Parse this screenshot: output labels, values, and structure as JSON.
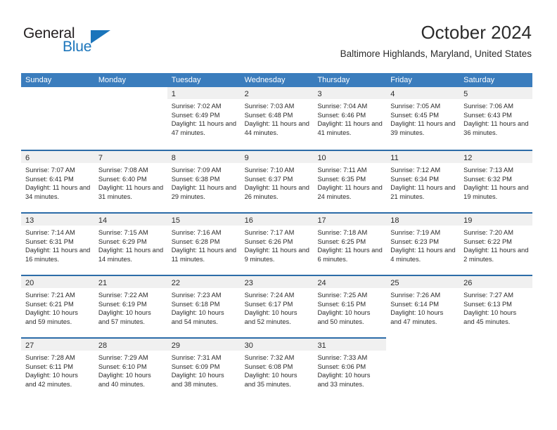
{
  "brand": {
    "name_part1": "General",
    "name_part2": "Blue",
    "accent_color": "#1b75bb"
  },
  "header": {
    "month_title": "October 2024",
    "location": "Baltimore Highlands, Maryland, United States"
  },
  "calendar": {
    "header_bg": "#3b7dbd",
    "rule_color": "#2c6ca8",
    "daynum_bg": "#f0f0f0",
    "weekdays": [
      "Sunday",
      "Monday",
      "Tuesday",
      "Wednesday",
      "Thursday",
      "Friday",
      "Saturday"
    ],
    "weeks": [
      [
        {
          "day": "",
          "empty": true
        },
        {
          "day": "",
          "empty": true
        },
        {
          "day": "1",
          "sunrise": "Sunrise: 7:02 AM",
          "sunset": "Sunset: 6:49 PM",
          "daylight": "Daylight: 11 hours and 47 minutes."
        },
        {
          "day": "2",
          "sunrise": "Sunrise: 7:03 AM",
          "sunset": "Sunset: 6:48 PM",
          "daylight": "Daylight: 11 hours and 44 minutes."
        },
        {
          "day": "3",
          "sunrise": "Sunrise: 7:04 AM",
          "sunset": "Sunset: 6:46 PM",
          "daylight": "Daylight: 11 hours and 41 minutes."
        },
        {
          "day": "4",
          "sunrise": "Sunrise: 7:05 AM",
          "sunset": "Sunset: 6:45 PM",
          "daylight": "Daylight: 11 hours and 39 minutes."
        },
        {
          "day": "5",
          "sunrise": "Sunrise: 7:06 AM",
          "sunset": "Sunset: 6:43 PM",
          "daylight": "Daylight: 11 hours and 36 minutes."
        }
      ],
      [
        {
          "day": "6",
          "sunrise": "Sunrise: 7:07 AM",
          "sunset": "Sunset: 6:41 PM",
          "daylight": "Daylight: 11 hours and 34 minutes."
        },
        {
          "day": "7",
          "sunrise": "Sunrise: 7:08 AM",
          "sunset": "Sunset: 6:40 PM",
          "daylight": "Daylight: 11 hours and 31 minutes."
        },
        {
          "day": "8",
          "sunrise": "Sunrise: 7:09 AM",
          "sunset": "Sunset: 6:38 PM",
          "daylight": "Daylight: 11 hours and 29 minutes."
        },
        {
          "day": "9",
          "sunrise": "Sunrise: 7:10 AM",
          "sunset": "Sunset: 6:37 PM",
          "daylight": "Daylight: 11 hours and 26 minutes."
        },
        {
          "day": "10",
          "sunrise": "Sunrise: 7:11 AM",
          "sunset": "Sunset: 6:35 PM",
          "daylight": "Daylight: 11 hours and 24 minutes."
        },
        {
          "day": "11",
          "sunrise": "Sunrise: 7:12 AM",
          "sunset": "Sunset: 6:34 PM",
          "daylight": "Daylight: 11 hours and 21 minutes."
        },
        {
          "day": "12",
          "sunrise": "Sunrise: 7:13 AM",
          "sunset": "Sunset: 6:32 PM",
          "daylight": "Daylight: 11 hours and 19 minutes."
        }
      ],
      [
        {
          "day": "13",
          "sunrise": "Sunrise: 7:14 AM",
          "sunset": "Sunset: 6:31 PM",
          "daylight": "Daylight: 11 hours and 16 minutes."
        },
        {
          "day": "14",
          "sunrise": "Sunrise: 7:15 AM",
          "sunset": "Sunset: 6:29 PM",
          "daylight": "Daylight: 11 hours and 14 minutes."
        },
        {
          "day": "15",
          "sunrise": "Sunrise: 7:16 AM",
          "sunset": "Sunset: 6:28 PM",
          "daylight": "Daylight: 11 hours and 11 minutes."
        },
        {
          "day": "16",
          "sunrise": "Sunrise: 7:17 AM",
          "sunset": "Sunset: 6:26 PM",
          "daylight": "Daylight: 11 hours and 9 minutes."
        },
        {
          "day": "17",
          "sunrise": "Sunrise: 7:18 AM",
          "sunset": "Sunset: 6:25 PM",
          "daylight": "Daylight: 11 hours and 6 minutes."
        },
        {
          "day": "18",
          "sunrise": "Sunrise: 7:19 AM",
          "sunset": "Sunset: 6:23 PM",
          "daylight": "Daylight: 11 hours and 4 minutes."
        },
        {
          "day": "19",
          "sunrise": "Sunrise: 7:20 AM",
          "sunset": "Sunset: 6:22 PM",
          "daylight": "Daylight: 11 hours and 2 minutes."
        }
      ],
      [
        {
          "day": "20",
          "sunrise": "Sunrise: 7:21 AM",
          "sunset": "Sunset: 6:21 PM",
          "daylight": "Daylight: 10 hours and 59 minutes."
        },
        {
          "day": "21",
          "sunrise": "Sunrise: 7:22 AM",
          "sunset": "Sunset: 6:19 PM",
          "daylight": "Daylight: 10 hours and 57 minutes."
        },
        {
          "day": "22",
          "sunrise": "Sunrise: 7:23 AM",
          "sunset": "Sunset: 6:18 PM",
          "daylight": "Daylight: 10 hours and 54 minutes."
        },
        {
          "day": "23",
          "sunrise": "Sunrise: 7:24 AM",
          "sunset": "Sunset: 6:17 PM",
          "daylight": "Daylight: 10 hours and 52 minutes."
        },
        {
          "day": "24",
          "sunrise": "Sunrise: 7:25 AM",
          "sunset": "Sunset: 6:15 PM",
          "daylight": "Daylight: 10 hours and 50 minutes."
        },
        {
          "day": "25",
          "sunrise": "Sunrise: 7:26 AM",
          "sunset": "Sunset: 6:14 PM",
          "daylight": "Daylight: 10 hours and 47 minutes."
        },
        {
          "day": "26",
          "sunrise": "Sunrise: 7:27 AM",
          "sunset": "Sunset: 6:13 PM",
          "daylight": "Daylight: 10 hours and 45 minutes."
        }
      ],
      [
        {
          "day": "27",
          "sunrise": "Sunrise: 7:28 AM",
          "sunset": "Sunset: 6:11 PM",
          "daylight": "Daylight: 10 hours and 42 minutes."
        },
        {
          "day": "28",
          "sunrise": "Sunrise: 7:29 AM",
          "sunset": "Sunset: 6:10 PM",
          "daylight": "Daylight: 10 hours and 40 minutes."
        },
        {
          "day": "29",
          "sunrise": "Sunrise: 7:31 AM",
          "sunset": "Sunset: 6:09 PM",
          "daylight": "Daylight: 10 hours and 38 minutes."
        },
        {
          "day": "30",
          "sunrise": "Sunrise: 7:32 AM",
          "sunset": "Sunset: 6:08 PM",
          "daylight": "Daylight: 10 hours and 35 minutes."
        },
        {
          "day": "31",
          "sunrise": "Sunrise: 7:33 AM",
          "sunset": "Sunset: 6:06 PM",
          "daylight": "Daylight: 10 hours and 33 minutes."
        },
        {
          "day": "",
          "empty": true
        },
        {
          "day": "",
          "empty": true
        }
      ]
    ]
  }
}
